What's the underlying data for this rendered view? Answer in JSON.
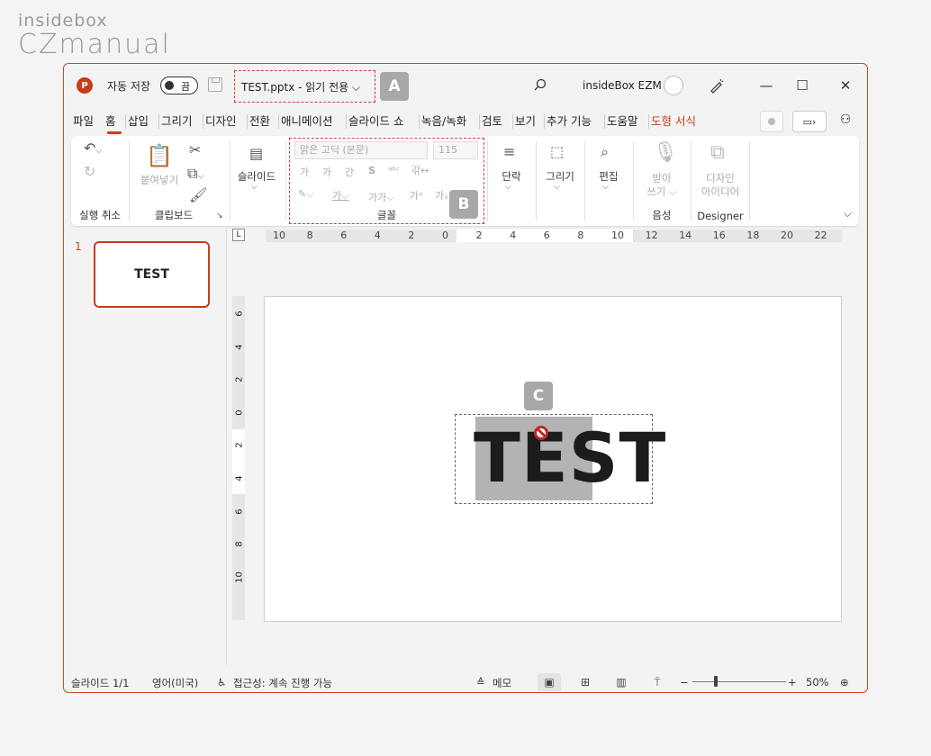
{
  "logo": {
    "top": "insidebox",
    "main": "CZmanual"
  },
  "titlebar": {
    "app_icon": "P",
    "autosave_label": "자동 저장",
    "autosave_state": "끔",
    "filename": "TEST.pptx  -  읽기 전용 ⌵",
    "user": "insideBox EZM"
  },
  "markers": {
    "a": "A",
    "b": "B",
    "c": "C"
  },
  "tabs": [
    "파일",
    "홈",
    "삽입",
    "그리기",
    "디자인",
    "전환",
    "애니메이션",
    "슬라이드 쇼",
    "녹음/녹화",
    "검토",
    "보기",
    "추가 기능",
    "도움말",
    "도형 서식"
  ],
  "ribbon": {
    "undo_group": "실행 취소",
    "clipboard_group": "클립보드",
    "paste": "붙여넣기",
    "slide": "슬라이드",
    "font_name": "맑은 고딕 (본문)",
    "font_size": "115",
    "font_group": "글꼴",
    "paragraph": "단락",
    "drawing": "그리기",
    "editing": "편집",
    "dictate_line1": "받아",
    "dictate_line2": "쓰기 ⌵",
    "voice_group": "음성",
    "designer_line1": "디자인",
    "designer_line2": "아이디어",
    "designer_group": "Designer"
  },
  "thumbnail": {
    "number": "1",
    "text": "TEST"
  },
  "slide": {
    "text": "TEST"
  },
  "ruler": {
    "h": [
      "10",
      "8",
      "6",
      "4",
      "2",
      "0",
      "2",
      "4",
      "6",
      "8",
      "10",
      "12",
      "14",
      "16",
      "18",
      "20",
      "22"
    ],
    "v": [
      "6",
      "4",
      "2",
      "0",
      "2",
      "4",
      "6",
      "8",
      "10"
    ]
  },
  "status": {
    "slide_count": "슬라이드 1/1",
    "language": "영어(미국)",
    "accessibility": "접근성: 계속 진행 가능",
    "notes": "메모",
    "zoom": "50%"
  },
  "colors": {
    "accent": "#c43e1c",
    "highlight_border": "#d23c3c",
    "marker": "#a8a8a8"
  }
}
